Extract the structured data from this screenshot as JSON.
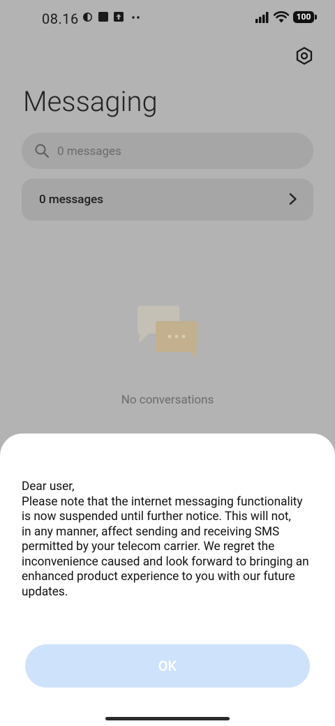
{
  "status_bar": {
    "time": "08.16",
    "battery": "100",
    "icons": [
      "moon-icon",
      "square-icon",
      "upload-icon",
      "more-dots-icon",
      "signal-icon",
      "wifi-icon"
    ]
  },
  "header": {
    "title": "Messaging",
    "settings_icon": "gear-icon"
  },
  "search": {
    "placeholder": "0 messages"
  },
  "messages_row": {
    "label": "0 messages"
  },
  "empty_state": {
    "icon": "chat-bubbles-icon",
    "text": "No conversations"
  },
  "dialog": {
    "message": "Dear user,\nPlease note that the internet messaging functionality\nis now suspended until further notice. This will not,\nin any manner, affect sending and receiving SMS\npermitted by your telecom carrier. We regret the\ninconvenience caused and look forward to bringing an\nenhanced product experience to you with our future\nupdates.",
    "ok_label": "OK"
  },
  "colors": {
    "overlay": "#b3b3b3",
    "button_bg": "#cfe2fc",
    "empty_icon": "#e8d3a8"
  }
}
